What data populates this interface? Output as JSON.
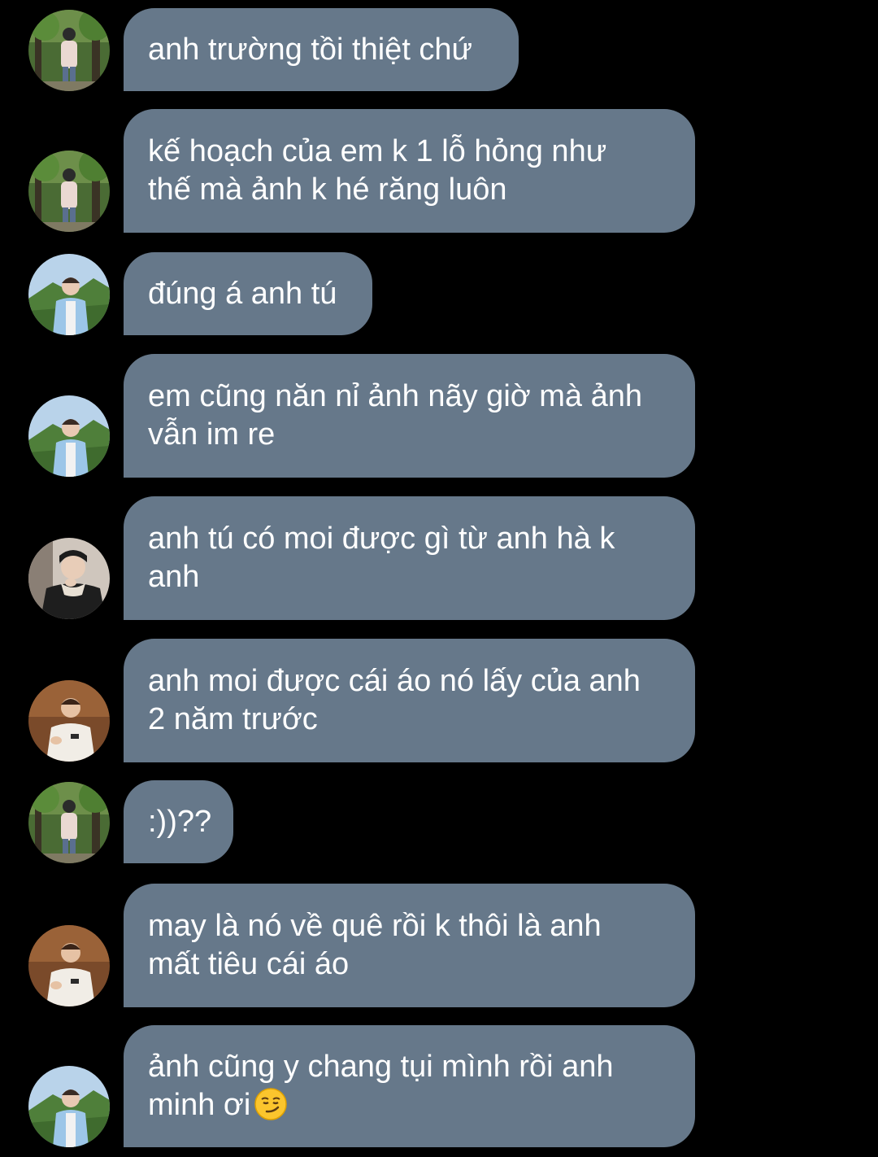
{
  "messages": [
    {
      "text": "anh trường tồi thiệt chứ",
      "avatar": "forest-man-avatar"
    },
    {
      "text": "kế hoạch của em k 1 lỗ hỏng như\nthế mà ảnh k hé răng luôn",
      "avatar": "forest-man-avatar"
    },
    {
      "text": "đúng á anh tú",
      "avatar": "mountain-man-avatar"
    },
    {
      "text": "em cũng năn nỉ ảnh nãy giờ mà ảnh\nvẫn im re",
      "avatar": "mountain-man-avatar"
    },
    {
      "text": "anh tú có moi được gì từ anh hà k\nanh",
      "avatar": "dark-hoodie-man-avatar"
    },
    {
      "text": "anh moi được cái áo nó lấy của anh\n2 năm trước",
      "avatar": "cafe-man-avatar"
    },
    {
      "text": ":))??",
      "avatar": "forest-man-avatar"
    },
    {
      "text": "may là nó về quê rồi k thôi là anh\nmất tiêu cái áo",
      "avatar": "cafe-man-avatar"
    },
    {
      "text": "ảnh cũng y chang tụi mình rồi anh\nminh ơi",
      "avatar": "mountain-man-avatar",
      "emoji": "smirk-emoji"
    }
  ],
  "colors": {
    "background": "#000000",
    "bubble": "#66788a",
    "text": "#ffffff"
  }
}
